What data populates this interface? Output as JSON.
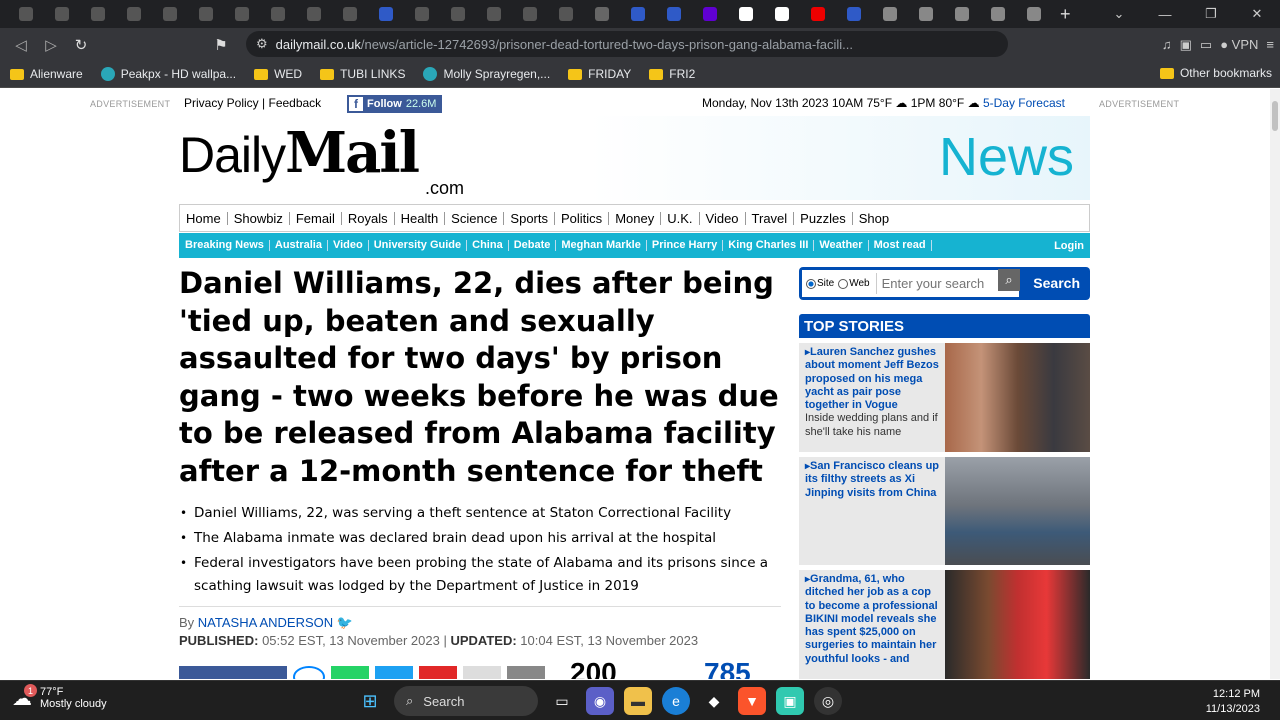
{
  "browser": {
    "tabs_count": 33,
    "url_host": "dailymail.co.uk",
    "url_path": "/news/article-12742693/prisoner-dead-tortured-two-days-prison-gang-alabama-facili...",
    "vpn_label": "VPN",
    "new_tab_symbol": "+",
    "bookmarks": [
      {
        "label": "Alienware",
        "icon": "folder-icon"
      },
      {
        "label": "Peakpx - HD wallpa...",
        "icon": "site-icon"
      },
      {
        "label": "WED",
        "icon": "folder-icon"
      },
      {
        "label": "TUBI LINKS",
        "icon": "folder-icon"
      },
      {
        "label": "Molly Sprayregen,...",
        "icon": "site-icon"
      },
      {
        "label": "FRIDAY",
        "icon": "folder-icon"
      },
      {
        "label": "FRI2",
        "icon": "folder-icon"
      }
    ],
    "other_bookmarks": "Other bookmarks"
  },
  "site": {
    "advertisement_label": "ADVERTISEMENT",
    "privacy": "Privacy Policy",
    "feedback": "Feedback",
    "fb_follow": "Follow",
    "fb_count": "22.6M",
    "date": "Monday, Nov 13th 2023",
    "w1_time": "10AM",
    "w1_temp": "75°F",
    "w2_time": "1PM",
    "w2_temp": "80°F",
    "forecast": "5-Day Forecast",
    "logo_daily": "Daily",
    "logo_mail": "Mail",
    "logo_com": ".com",
    "section_title": "News",
    "main_nav": [
      "Home",
      "Showbiz",
      "Femail",
      "Royals",
      "Health",
      "Science",
      "Sports",
      "Politics",
      "Money",
      "U.K.",
      "Video",
      "Travel",
      "Puzzles",
      "Shop"
    ],
    "sub_nav": [
      "Breaking News",
      "Australia",
      "Video",
      "University Guide",
      "China",
      "Debate",
      "Meghan Markle",
      "Prince Harry",
      "King Charles III",
      "Weather",
      "Most read"
    ],
    "login": "Login"
  },
  "article": {
    "headline": "Daniel Williams, 22, dies after being 'tied up, beaten and sexually assaulted for two days' by prison gang - two weeks before he was due to be released from Alabama facility after a 12-month sentence for theft",
    "bullets": [
      "Daniel Williams, 22, was serving a theft sentence at Staton Correctional Facility",
      "The Alabama inmate was declared brain dead upon his arrival at the hospital",
      "Federal investigators have been probing the state of Alabama and its prisons since a scathing lawsuit was lodged by the Department of Justice in 2019"
    ],
    "by": "By",
    "author": "NATASHA ANDERSON",
    "published_label": "PUBLISHED:",
    "published": "05:52 EST, 13 November 2023",
    "updated_label": "UPDATED:",
    "updated": "10:04 EST, 13 November 2023",
    "share_count": "200",
    "comment_count": "785"
  },
  "sidebar": {
    "search_site": "Site",
    "search_web": "Web",
    "search_placeholder": "Enter your search",
    "search_button": "Search",
    "top_stories_title": "TOP STORIES",
    "stories": [
      {
        "text": "Lauren Sanchez gushes about moment Jeff Bezos proposed on his mega yacht as pair pose together in Vogue",
        "sub": "Inside wedding plans and if she'll take his name"
      },
      {
        "text": "San Francisco cleans up its filthy streets as Xi Jinping visits from China",
        "sub": ""
      },
      {
        "text": "Grandma, 61, who ditched her job as a cop to become a professional BIKINI model reveals she has spent $25,000 on surgeries to maintain her youthful looks - and",
        "sub": ""
      }
    ]
  },
  "taskbar": {
    "temp": "77°F",
    "condition": "Mostly cloudy",
    "badge": "1",
    "search": "Search",
    "time": "12:12 PM",
    "date": "11/13/2023"
  },
  "colors": {
    "accent": "#16b3d1",
    "blue": "#004db3"
  }
}
